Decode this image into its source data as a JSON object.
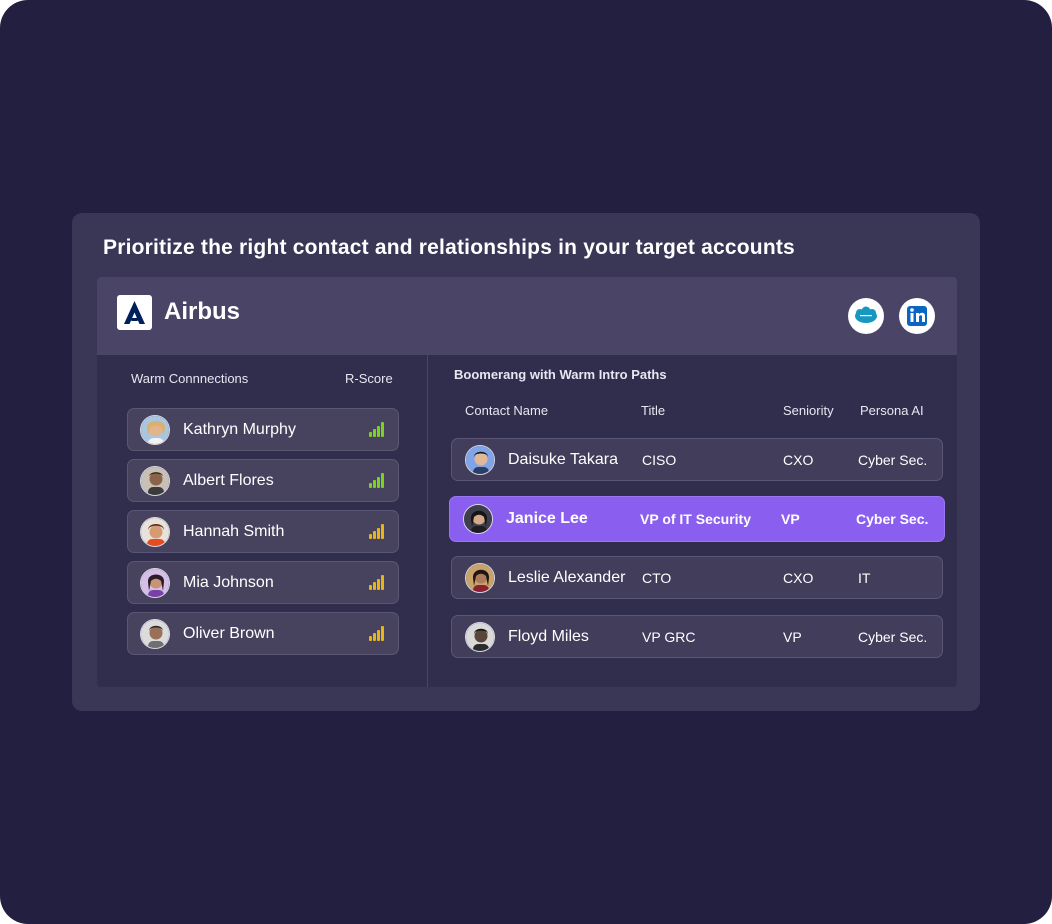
{
  "headline": "Prioritize the right contact and relationships in your target accounts",
  "account": {
    "name": "Airbus",
    "integrations": [
      "salesforce-icon",
      "linkedin-icon"
    ]
  },
  "warm_connections": {
    "header": "Warm Connnections",
    "score_header": "R-Score",
    "items": [
      {
        "name": "Kathryn Murphy",
        "score": 4,
        "score_max": 4,
        "color": "#7bd321"
      },
      {
        "name": "Albert Flores",
        "score": 4,
        "score_max": 4,
        "color": "#7bd321"
      },
      {
        "name": "Hannah Smith",
        "score": 4,
        "score_max": 4,
        "color": "#e8b516"
      },
      {
        "name": "Mia Johnson",
        "score": 4,
        "score_max": 4,
        "color": "#e8b516"
      },
      {
        "name": "Oliver Brown",
        "score": 4,
        "score_max": 4,
        "color": "#e8b516"
      }
    ]
  },
  "intro_paths": {
    "title": "Boomerang with Warm Intro Paths",
    "columns": [
      "Contact Name",
      "Title",
      "Seniority",
      "Persona AI"
    ],
    "rows": [
      {
        "name": "Daisuke Takara",
        "title": "CISO",
        "seniority": "CXO",
        "persona": "Cyber Sec.",
        "selected": false
      },
      {
        "name": "Janice Lee",
        "title": "VP of IT Security",
        "seniority": "VP",
        "persona": "Cyber Sec.",
        "selected": true
      },
      {
        "name": "Leslie Alexander",
        "title": "CTO",
        "seniority": "CXO",
        "persona": "IT",
        "selected": false
      },
      {
        "name": "Floyd Miles",
        "title": "VP GRC",
        "seniority": "VP",
        "persona": "Cyber Sec.",
        "selected": false
      }
    ]
  },
  "colors": {
    "background": "#231f40",
    "card": "#3a3656",
    "accent": "#8a5ff0",
    "score_high": "#7bd321",
    "score_mid": "#e8b516"
  }
}
